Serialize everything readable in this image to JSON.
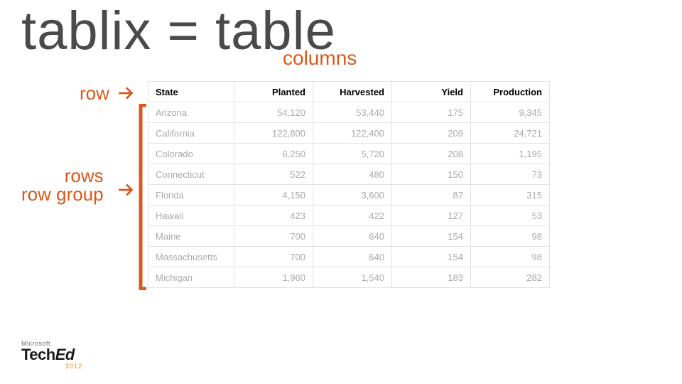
{
  "title": "tablix = table",
  "labels": {
    "columns": "columns",
    "row": "row",
    "rows": "rows",
    "row_group": "row group"
  },
  "table": {
    "headers": [
      "State",
      "Planted",
      "Harvested",
      "Yield",
      "Production"
    ],
    "rows": [
      {
        "state": "Arizona",
        "planted": "54,120",
        "harvested": "53,440",
        "yield": "175",
        "production": "9,345"
      },
      {
        "state": "California",
        "planted": "122,800",
        "harvested": "122,400",
        "yield": "209",
        "production": "24,721"
      },
      {
        "state": "Colorado",
        "planted": "6,250",
        "harvested": "5,720",
        "yield": "208",
        "production": "1,195"
      },
      {
        "state": "Connecticut",
        "planted": "522",
        "harvested": "480",
        "yield": "150",
        "production": "73"
      },
      {
        "state": "Florida",
        "planted": "4,150",
        "harvested": "3,600",
        "yield": "87",
        "production": "315"
      },
      {
        "state": "Hawaii",
        "planted": "423",
        "harvested": "422",
        "yield": "127",
        "production": "53"
      },
      {
        "state": "Maine",
        "planted": "700",
        "harvested": "640",
        "yield": "154",
        "production": "98"
      },
      {
        "state": "Massachusetts",
        "planted": "700",
        "harvested": "640",
        "yield": "154",
        "production": "98"
      },
      {
        "state": "Michigan",
        "planted": "1,960",
        "harvested": "1,540",
        "yield": "183",
        "production": "282"
      }
    ]
  },
  "footer": {
    "brand_small": "Microsoft",
    "brand_main_a": "Tech",
    "brand_main_b": "Ed",
    "year": "2012"
  },
  "chart_data": {
    "type": "table",
    "columns": [
      "State",
      "Planted",
      "Harvested",
      "Yield",
      "Production"
    ],
    "rows": [
      [
        "Arizona",
        54120,
        53440,
        175,
        9345
      ],
      [
        "California",
        122800,
        122400,
        209,
        24721
      ],
      [
        "Colorado",
        6250,
        5720,
        208,
        1195
      ],
      [
        "Connecticut",
        522,
        480,
        150,
        73
      ],
      [
        "Florida",
        4150,
        3600,
        87,
        315
      ],
      [
        "Hawaii",
        423,
        422,
        127,
        53
      ],
      [
        "Maine",
        700,
        640,
        154,
        98
      ],
      [
        "Massachusetts",
        700,
        640,
        154,
        98
      ],
      [
        "Michigan",
        1960,
        1540,
        183,
        282
      ]
    ]
  }
}
